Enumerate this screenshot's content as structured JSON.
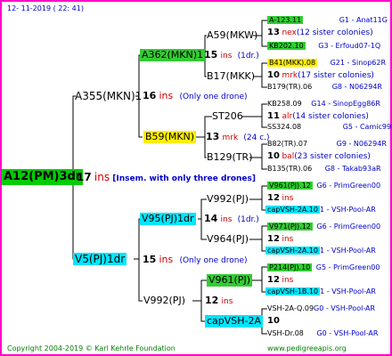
{
  "header": {
    "date": "12- 11-2019 ( 22: 41)"
  },
  "footer": {
    "copyright": "Copyright 2004-2019 © Karl Kehrle Foundation",
    "site": "www.pedigreeapis.org"
  },
  "root": {
    "name": "A12(PM)3dr",
    "ins": "17",
    "ins_label": "ins",
    "note": "[Insem. with only three drones]"
  },
  "l1a": {
    "name": "A355(MKN)1",
    "ins": "16",
    "ins_label": "ins",
    "note": "(Only one drone)"
  },
  "l1b": {
    "name": "V5(PJ)1dr",
    "ins": "15",
    "ins_label": "ins",
    "note": "(Only one drone)"
  },
  "l2a": {
    "name": "A362(MKN)1",
    "ins": "15",
    "ins_label": "ins",
    "note": "(1dr.)"
  },
  "l2b": {
    "name": "B59(MKN)",
    "ins": "13",
    "ins_label": "mrk",
    "note": "(24 c.)"
  },
  "l2c": {
    "name": "V95(PJ)1dr",
    "ins": "14",
    "ins_label": "ins",
    "note": "(1dr.)"
  },
  "l2d": {
    "name": "V992(PJ)",
    "ins": "12",
    "ins_label": "ins"
  },
  "l3": {
    "a1": "A59(MKW)",
    "a2": "B17(MKK)",
    "b1": "ST206",
    "b2": "B129(TR)",
    "c1": "V992(PJ)",
    "c2": "V964(PJ)",
    "d1": "V961(PJ)",
    "d2": "capVSH-2A"
  },
  "l4": [
    {
      "pre": "A-123.11",
      "code": "G1 - Anat11G"
    },
    {
      "num": "13",
      "lab": "nex",
      "note": "(12 sister colonies)"
    },
    {
      "pre": "KB202.10",
      "code": "G3 - Erfoud07-1Q"
    },
    {
      "pre": "B41(MKK).08",
      "code": "G21 - Sinop62R"
    },
    {
      "num": "10",
      "lab": "mrk",
      "note": "(17 sister colonies)"
    },
    {
      "pre": "B179(TR).06",
      "code": "G8 - N06294R"
    },
    {
      "pre": "KB258.09",
      "code": "G14 - SinopEgg86R"
    },
    {
      "num": "11",
      "lab": "alr",
      "note": "(14 sister colonies)"
    },
    {
      "pre": "SS324.08",
      "code": "G5 - Camic99R"
    },
    {
      "pre": "B82(TR).07",
      "code": "G9 - N06294R"
    },
    {
      "num": "10",
      "lab": "bal",
      "note": "(23 sister colonies)"
    },
    {
      "pre": "B135(TR).06",
      "code": "G8 - Takab93aR"
    },
    {
      "pre": "V961(PJ).12",
      "code": "G6 - PrimGreen00"
    },
    {
      "num": "12",
      "lab": "ins",
      "note": ""
    },
    {
      "pre": "capVSH-2A.10",
      "code": "1 - VSH-Pool-AR"
    },
    {
      "pre": "V971(PJ).12",
      "code": "G6 - PrimGreen00"
    },
    {
      "num": "12",
      "lab": "ins",
      "note": ""
    },
    {
      "pre": "capVSH-2A.10",
      "code": "1 - VSH-Pool-AR"
    },
    {
      "pre": "P214(PJ).10",
      "code": "G5 - PrimGreen00"
    },
    {
      "num": "12",
      "lab": "ins",
      "note": ""
    },
    {
      "pre": "capVSH-1B.10",
      "code": "1 - VSH-Pool-AR"
    },
    {
      "pre": "VSH-2A-Q.09",
      "code": "G0 - VSH-Pool-AR"
    },
    {
      "num": "10",
      "lab": "",
      "note": ""
    },
    {
      "pre": "VSH-Dr.08",
      "code": "G0 - VSH-Pool-AR"
    }
  ]
}
